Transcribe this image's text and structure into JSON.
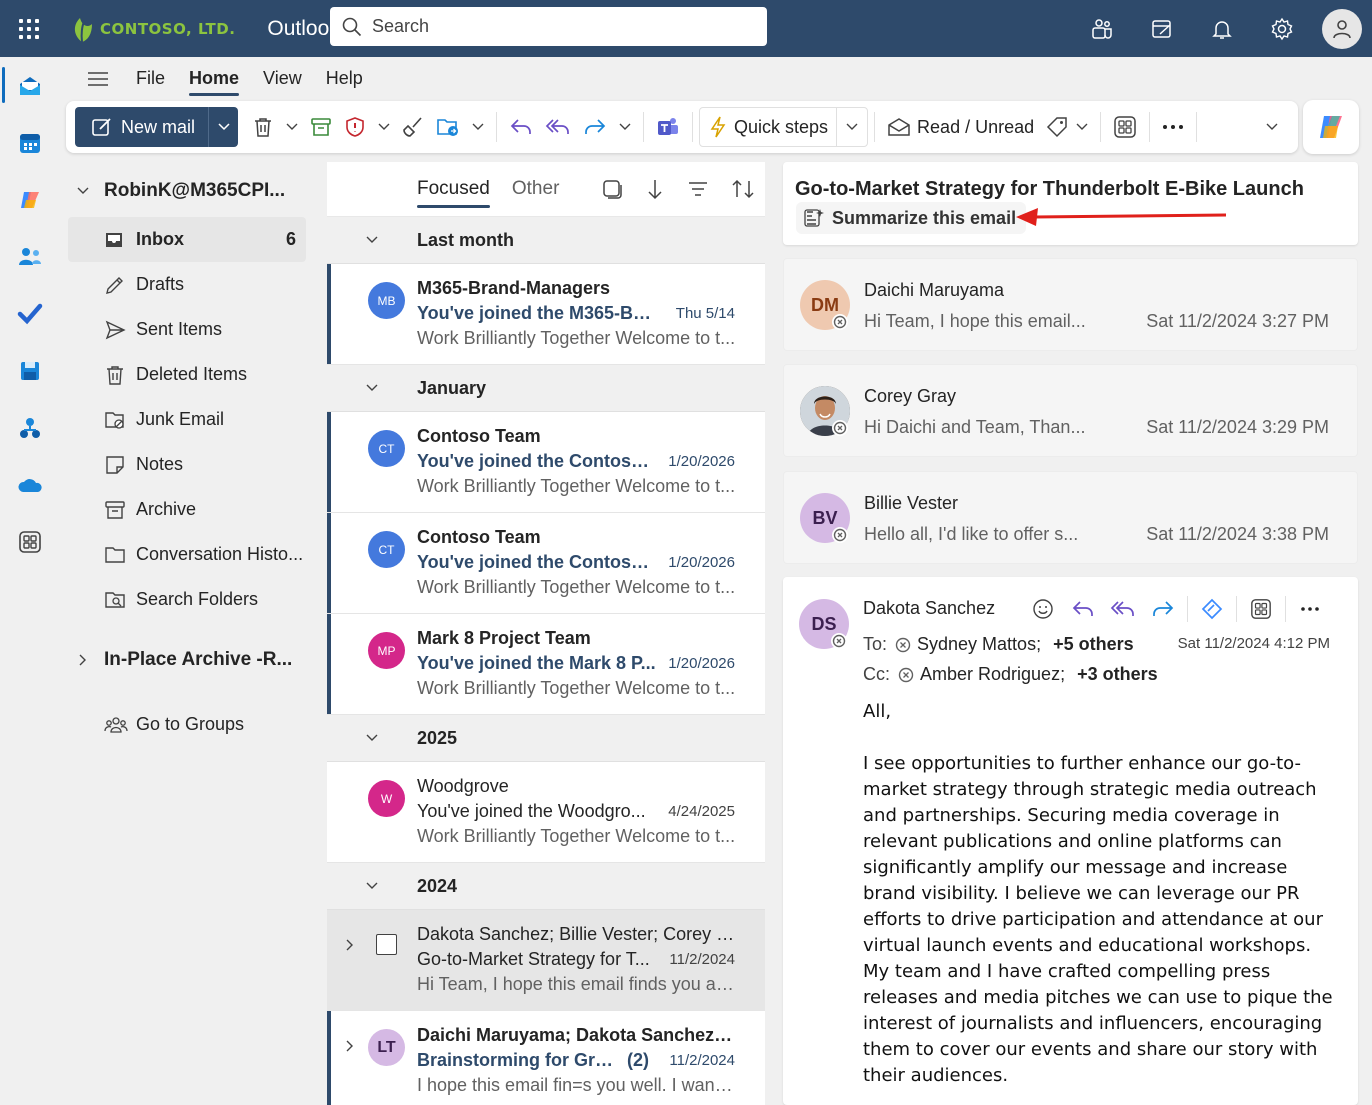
{
  "topbar": {
    "logo_text": "CONTOSO, LTD.",
    "app_name": "Outlook",
    "search_placeholder": "Search"
  },
  "ribbon_tabs": [
    "File",
    "Home",
    "View",
    "Help"
  ],
  "toolbar": {
    "new_mail": "New mail",
    "quick_steps": "Quick steps",
    "read_unread": "Read / Unread"
  },
  "folders": {
    "account": "RobinK@M365CPI...",
    "items": [
      {
        "label": "Inbox",
        "count": "6"
      },
      {
        "label": "Drafts"
      },
      {
        "label": "Sent Items"
      },
      {
        "label": "Deleted Items"
      },
      {
        "label": "Junk Email"
      },
      {
        "label": "Notes"
      },
      {
        "label": "Archive"
      },
      {
        "label": "Conversation Histo..."
      },
      {
        "label": "Search Folders"
      }
    ],
    "archive": "In-Place Archive -R...",
    "groups": "Go to Groups"
  },
  "list": {
    "tab_focused": "Focused",
    "tab_other": "Other",
    "groups": [
      "Last month",
      "January",
      "2025",
      "2024"
    ],
    "messages": [
      {
        "initials": "MB",
        "from": "M365-Brand-Managers",
        "subject": "You've joined the M365-Bra...",
        "date": "Thu 5/14",
        "preview": "Work Brilliantly Together Welcome to t..."
      },
      {
        "initials": "CT",
        "from": "Contoso Team",
        "subject": "You've joined the Contoso ...",
        "date": "1/20/2026",
        "preview": "Work Brilliantly Together Welcome to t..."
      },
      {
        "initials": "CT",
        "from": "Contoso Team",
        "subject": "You've joined the Contoso ...",
        "date": "1/20/2026",
        "preview": "Work Brilliantly Together Welcome to t..."
      },
      {
        "initials": "MP",
        "from": "Mark 8 Project Team",
        "subject": "You've joined the Mark 8 P...",
        "date": "1/20/2026",
        "preview": "Work Brilliantly Together Welcome to t..."
      },
      {
        "initials": "W",
        "from": "Woodgrove",
        "subject": "You've joined the Woodgro...",
        "date": "4/24/2025",
        "preview": "Work Brilliantly Together Welcome to t..."
      },
      {
        "from": "Dakota Sanchez; Billie Vester; Corey G...",
        "subject": "Go-to-Market Strategy for T...",
        "date": "11/2/2024",
        "preview": "Hi Team, I hope this email finds you all ..."
      },
      {
        "initials": "LT",
        "from": "Daichi Maruyama; Dakota Sanchez; T...",
        "subject": "Brainstorming for Gran...",
        "count": "(2)",
        "date": "11/2/2024",
        "preview": "I hope this email fin=s you well. I wante..."
      }
    ]
  },
  "reading": {
    "title": "Go-to-Market Strategy for Thunderbolt E-Bike Launch",
    "summarize": "Summarize this email",
    "cards": [
      {
        "initials": "DM",
        "name": "Daichi Maruyama",
        "snippet": "Hi Team, I hope this email...",
        "when": "Sat 11/2/2024 3:27 PM"
      },
      {
        "name": "Corey Gray",
        "snippet": "Hi Daichi and Team, Than...",
        "when": "Sat 11/2/2024 3:29 PM"
      },
      {
        "initials": "BV",
        "name": "Billie Vester",
        "snippet": "Hello all, I'd like to offer s...",
        "when": "Sat 11/2/2024 3:38 PM"
      }
    ],
    "full": {
      "initials": "DS",
      "name": "Dakota Sanchez",
      "to_label": "To:",
      "to_name": "Sydney Mattos;",
      "to_more": "+5 others",
      "cc_label": "Cc:",
      "cc_name": "Amber Rodriguez;",
      "cc_more": "+3 others",
      "date": "Sat 11/2/2024 4:12 PM",
      "greeting": "All,",
      "body": "I see opportunities to further enhance our go-to-market strategy through strategic media outreach and partnerships. Securing media coverage in relevant publications and online platforms can significantly amplify our message and increase brand visibility. I believe we can leverage our PR efforts to drive participation and attendance at our virtual launch events and educational workshops. My team and I have crafted compelling press releases and media pitches we can use to pique the interest of journalists and influencers, encouraging them to cover our events and share our story with their audiences."
    }
  },
  "colors": {
    "brand": "#2e4a6b",
    "logo_green": "#8cc43f",
    "arrow": "#e0201b"
  }
}
